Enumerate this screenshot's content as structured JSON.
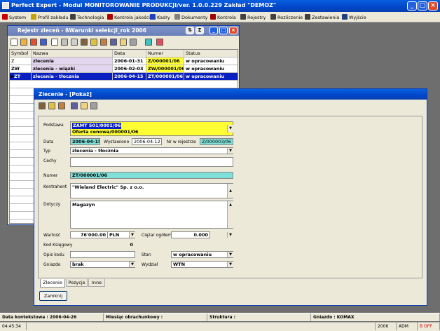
{
  "app": {
    "title": "Perfect Expert - Modul MONITOROWANIE PRODUKCJI/ver. 1.0.0.229 Zakład \"DEMOZ\""
  },
  "menu": [
    {
      "label": "System",
      "icon": "checkmark-icon",
      "color": "#cc0000"
    },
    {
      "label": "Profil zakładu",
      "icon": "key-icon",
      "color": "#c8a000"
    },
    {
      "label": "Technologia",
      "icon": "people-icon",
      "color": "#404040"
    },
    {
      "label": "Kontrola jakości",
      "icon": "inspection-icon",
      "color": "#b00000"
    },
    {
      "label": "Kadry",
      "icon": "person-icon",
      "color": "#2040c0"
    },
    {
      "label": "Dokumenty",
      "icon": "documents-icon",
      "color": "#808080"
    },
    {
      "label": "Kontrola",
      "icon": "control-icon",
      "color": "#a00000"
    },
    {
      "label": "Rejestry",
      "icon": "registers-icon",
      "color": "#404040"
    },
    {
      "label": "Rozliczenie",
      "icon": "settlement-icon",
      "color": "#404040"
    },
    {
      "label": "Zestawienia",
      "icon": "reports-icon",
      "color": "#404040"
    },
    {
      "label": "Wyjście",
      "icon": "exit-icon",
      "color": "#204080"
    }
  ],
  "reg_window": {
    "title": "Rejestr zleceń - ßWarunki selekcji_rok 2006",
    "columns": [
      "Symbol",
      "Nazwa",
      "Data",
      "Numer",
      "Status"
    ],
    "rows": [
      {
        "symbol": "Z",
        "nazwa": "zlecenia",
        "data": "2006-01-31",
        "numer": "Z/000001/06",
        "status": "w opracowaniu"
      },
      {
        "symbol": "ZW",
        "nazwa": "zlecenia - wiązki",
        "data": "2006-02-03",
        "numer": "ZW/000001/06",
        "status": "w opracowaniu"
      },
      {
        "symbol": "ZT",
        "nazwa": "zlecenia - tłocznia",
        "data": "2006-04-15",
        "numer": "ZT/000001/06",
        "status": "w opracowaniu"
      }
    ]
  },
  "detail": {
    "title": "Zlecenie - [Pokaż]",
    "labels": {
      "podstawa": "Podstawa",
      "data": "Data",
      "wystawiono": "Wystawiono",
      "nr_rej": "Nr w rejestrze",
      "typ": "Typ",
      "cechy": "Cechy",
      "numer": "Numer",
      "kontrahent": "Kontrahent",
      "dotyczy": "Dotyczy",
      "wartosc": "Wartość",
      "ciezar": "Ciężar ogółem",
      "kod_ks": "Kod Księgowy",
      "opis_kodu": "Opis kodu",
      "stan": "Stan",
      "gniazdo": "Gniazdo",
      "wydzial": "Wydział"
    },
    "values": {
      "podstawa_1": "ZAMT 501/0001/06",
      "podstawa_2": "Oferta cenowa/000001/06",
      "data": "2006-04-15",
      "wystawiono": "2006-04-12",
      "nr_rej": "Z/000003/06",
      "typ": "zlecenia - tłocznia",
      "numer": "ZT/000001/06",
      "kontrahent": "\"Wieland Electric\" Sp. z o.o.",
      "dotyczy": "Magazyn",
      "wartosc": "76'000.00",
      "waluta": "PLN",
      "ciezar": "0.000",
      "kod_ks": "0",
      "stan": "w opracowaniu",
      "gniazdo": "brak",
      "wydzial": "WTN"
    },
    "tabs": [
      "Zlecenie",
      "Pozycje",
      "Inne"
    ],
    "close_button": "Zamknij"
  },
  "statusbar": {
    "data_kontekstowa": "Data kontekstowa : 2006-04-26",
    "miesiac": "Miesiąc obrachunkowy :",
    "struktura": "Struktura :",
    "gniazdo": "Gniazdo : KOMAX",
    "time": "04:45:34",
    "year": "2006",
    "user": "ADM",
    "flag": "B OFF"
  },
  "colors": {
    "accent": "#0a3fb0",
    "yellow": "#ffff33",
    "cyan": "#7fe0d8",
    "selected": "#0a1fc0",
    "lilac": "#e2d6ee",
    "bg": "#6e6e6e"
  }
}
